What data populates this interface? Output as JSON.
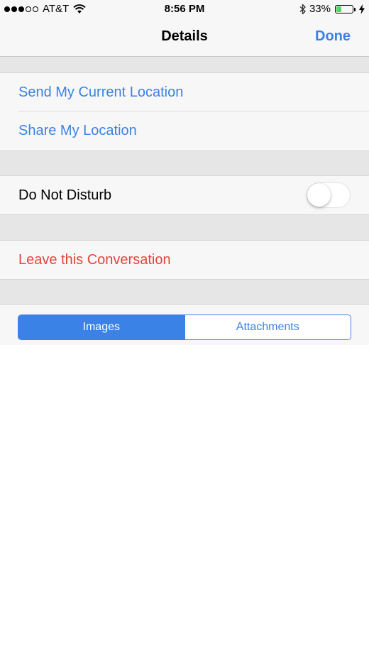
{
  "status_bar": {
    "signal_filled": 3,
    "signal_total": 5,
    "carrier": "AT&T",
    "time": "8:56 PM",
    "battery_percent": "33%",
    "battery_level": 0.33,
    "icons": [
      "wifi-icon",
      "bluetooth-icon",
      "battery-icon",
      "charging-bolt-icon"
    ]
  },
  "nav": {
    "title": "Details",
    "done_label": "Done"
  },
  "location": {
    "send_current": "Send My Current Location",
    "share": "Share My Location"
  },
  "settings": {
    "do_not_disturb_label": "Do Not Disturb",
    "do_not_disturb_on": false
  },
  "actions": {
    "leave_conversation": "Leave this Conversation"
  },
  "segments": {
    "items": [
      "Images",
      "Attachments"
    ],
    "selected_index": 0
  },
  "colors": {
    "accent": "#3b82e6",
    "destructive": "#e0463c",
    "battery_fill": "#4cd964",
    "group_background": "#e6e6e6"
  }
}
